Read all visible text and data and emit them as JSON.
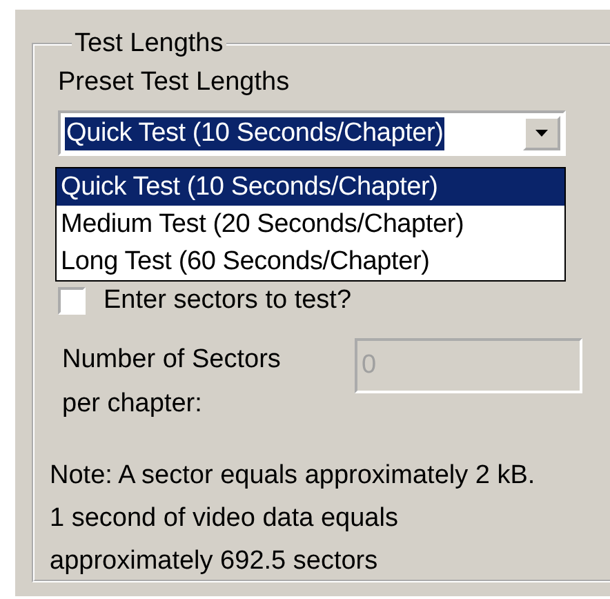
{
  "group": {
    "title": "Test Lengths"
  },
  "preset": {
    "label": "Preset Test Lengths",
    "value": "Quick Test (10 Seconds/Chapter)",
    "expanded": true,
    "options": [
      {
        "label": "Quick Test (10 Seconds/Chapter)",
        "selected": true
      },
      {
        "label": "Medium Test (20 Seconds/Chapter)",
        "selected": false
      },
      {
        "label": "Long Test (60 Seconds/Chapter)",
        "selected": false
      }
    ]
  },
  "enter_sectors": {
    "label": "Enter sectors to test?",
    "checked": false
  },
  "sectors": {
    "label": "Number of Sectors per chapter:",
    "value": "0",
    "disabled": true
  },
  "note": "Note: A sector equals approximately 2 kB.\n1 second of video data equals\napproximately 692.5 sectors"
}
